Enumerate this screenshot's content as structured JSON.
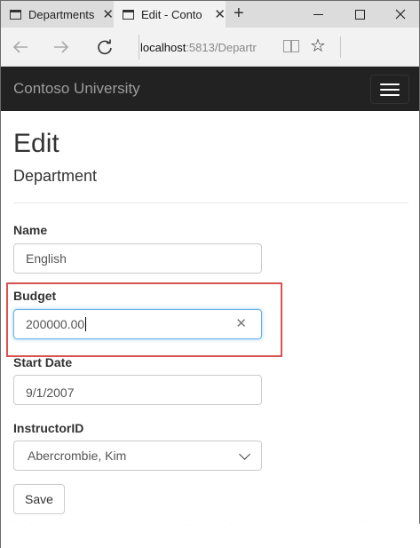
{
  "browser": {
    "tabs": [
      {
        "title": "Departments -",
        "active": false
      },
      {
        "title": "Edit - Conto",
        "active": true
      }
    ],
    "new_tab_glyph": "+",
    "address": {
      "host": "localhost",
      "path": ":5813/Departr"
    },
    "icons": [
      "page-icon",
      "close-icon",
      "back-icon",
      "forward-icon",
      "refresh-icon",
      "reading-view-icon",
      "favorite-star-icon",
      "minimize-icon",
      "maximize-icon",
      "window-close-icon"
    ]
  },
  "site": {
    "brand": "Contoso University",
    "menu_icon": "hamburger-menu-icon"
  },
  "page": {
    "title": "Edit",
    "subtitle": "Department",
    "fields": {
      "name": {
        "label": "Name",
        "value": "English"
      },
      "budget": {
        "label": "Budget",
        "value": "200000.00"
      },
      "start_date": {
        "label": "Start Date",
        "value": "9/1/2007"
      },
      "instructor": {
        "label": "InstructorID",
        "value": "Abercrombie, Kim"
      }
    },
    "save_label": "Save"
  },
  "colors": {
    "navbar_bg": "#222222",
    "brand_text": "#9d9d9d",
    "highlight_border": "#d9534f",
    "focus_border": "#66afe9"
  }
}
